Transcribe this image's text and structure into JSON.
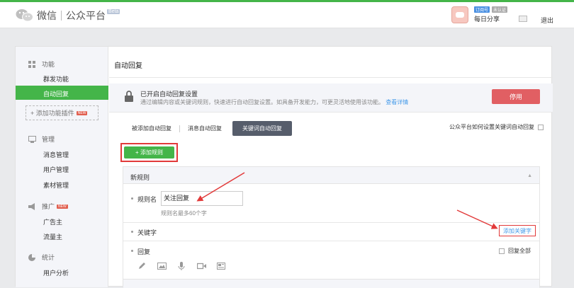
{
  "header": {
    "logo_text": "微信",
    "platform_name": "公众平台",
    "beta": "Beta",
    "badge_subscription": "订阅号",
    "badge_unverified": "未认证",
    "username": "每日分享",
    "logout": "退出"
  },
  "sidebar": {
    "groups": [
      {
        "label": "功能",
        "items": [
          "群发功能",
          "自动回复"
        ]
      },
      {
        "label": "管理",
        "items": [
          "消息管理",
          "用户管理",
          "素材管理"
        ]
      },
      {
        "label": "推广",
        "items": [
          "广告主",
          "流量主"
        ]
      },
      {
        "label": "统计",
        "items": [
          "用户分析"
        ]
      }
    ],
    "add_plugin": "+ 添加功能插件",
    "new_badge": "NEW",
    "active_item": "自动回复"
  },
  "main": {
    "title": "自动回复",
    "notice_title": "已开启自动回复设置",
    "notice_desc": "通过编辑内容或关键词规则，快速进行自动回复设置。如具备开发能力，可更灵活地使用该功能。",
    "notice_link": "查看详情",
    "disable_button": "停用",
    "tabs": [
      "被添加自动回复",
      "消息自动回复",
      "关键词自动回复"
    ],
    "active_tab": "关键词自动回复",
    "help_link": "公众平台如何设置关键词自动回复",
    "add_rule_button": "+ 添加规则",
    "rule": {
      "header": "新规则",
      "name_label": "规则名",
      "name_value": "关注回复",
      "name_hint": "规则名最多60个字",
      "keyword_label": "关键字",
      "add_keyword": "添加关键字",
      "reply_label": "回复",
      "reply_all": "回复全部"
    }
  },
  "colors": {
    "brand_green": "#44b549",
    "danger_red": "#e15f63",
    "link_blue": "#459ae9",
    "annotation_red": "#e23a3a"
  }
}
